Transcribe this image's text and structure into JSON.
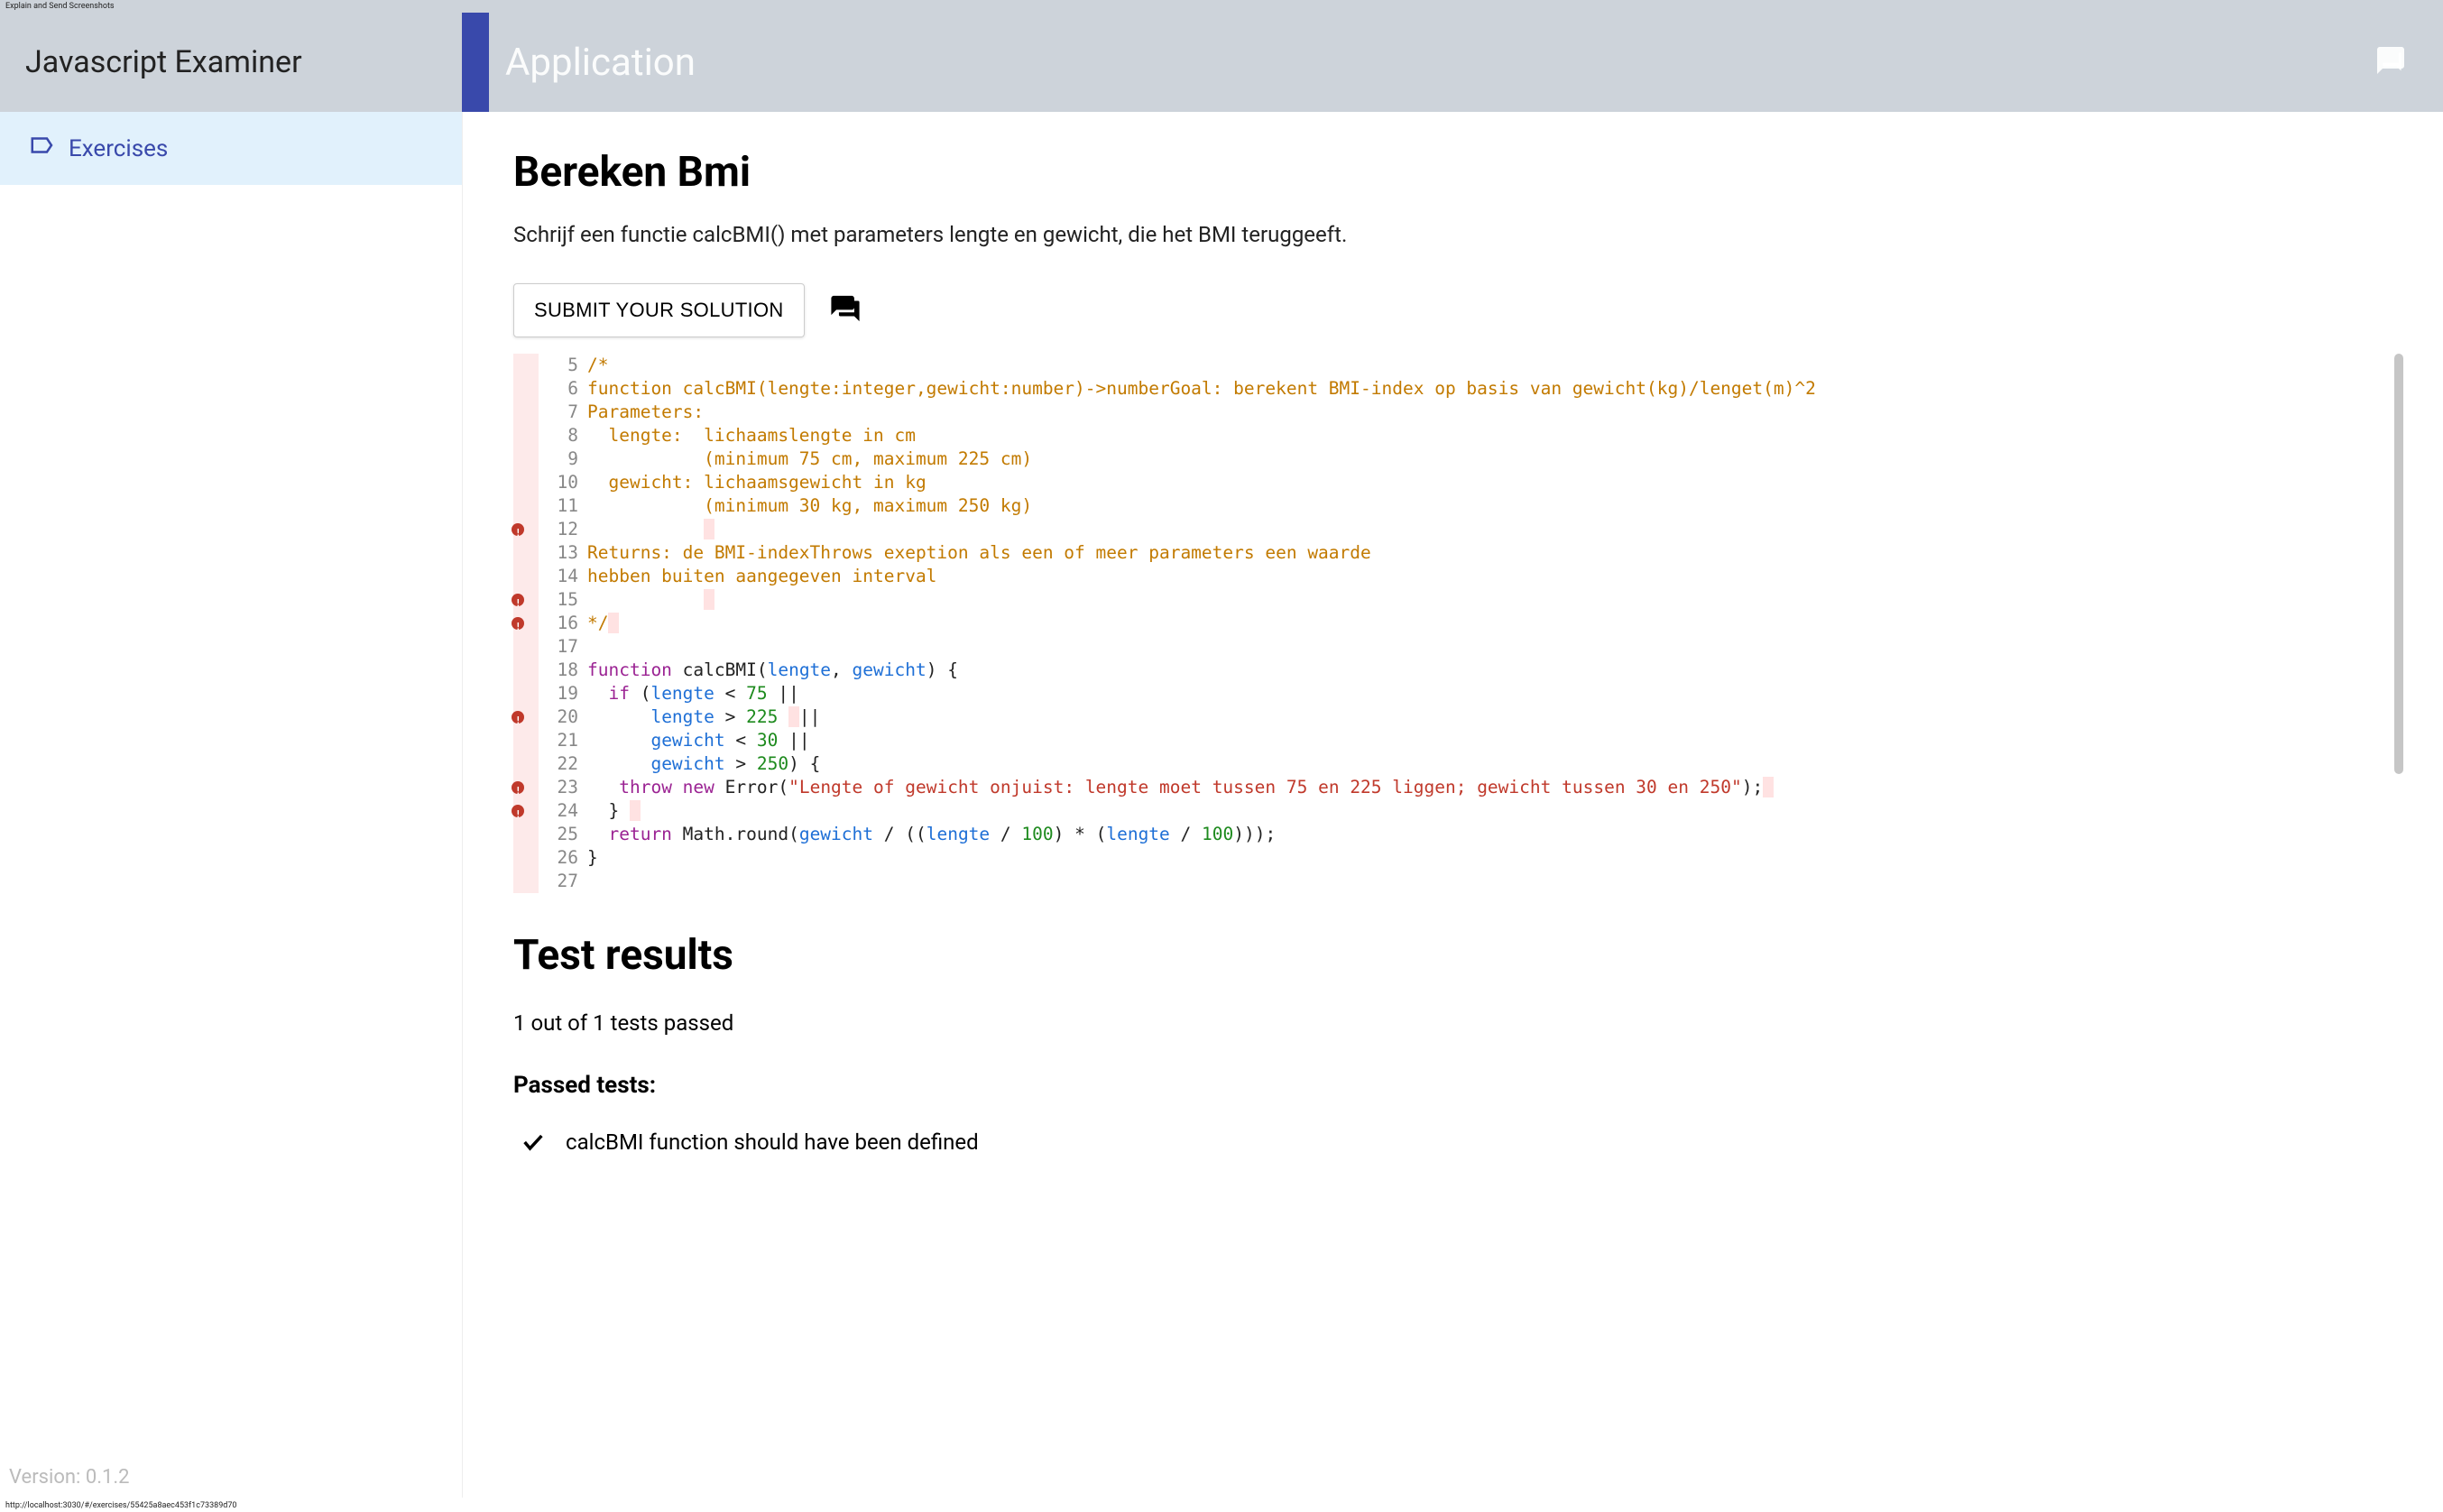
{
  "tiny_bar": "Explain and Send Screenshots",
  "header": {
    "app_name": "Javascript Examiner",
    "title": "Application"
  },
  "sidebar": {
    "items": [
      {
        "label": "Exercises"
      }
    ],
    "version": "Version: 0.1.2"
  },
  "main": {
    "title": "Bereken Bmi",
    "description": "Schrijf een functie calcBMI() met parameters lengte en gewicht, die het BMI teruggeeft.",
    "submit_label": "SUBMIT YOUR SOLUTION"
  },
  "editor": {
    "first_line_number": 5,
    "error_lines": [
      12,
      15,
      16,
      20,
      23,
      24
    ],
    "lines": [
      [
        {
          "cls": "tok-comment",
          "t": "/*"
        }
      ],
      [
        {
          "cls": "tok-comment",
          "t": "function calcBMI(lengte:integer,gewicht:number)->numberGoal: berekent BMI-index op basis van gewicht(kg)/lenget(m)^2"
        }
      ],
      [
        {
          "cls": "tok-comment",
          "t": "Parameters:"
        }
      ],
      [
        {
          "cls": "tok-comment",
          "t": "  lengte:  lichaamslengte in cm "
        }
      ],
      [
        {
          "cls": "tok-comment",
          "t": "           (minimum 75 cm, maximum 225 cm)"
        }
      ],
      [
        {
          "cls": "tok-comment",
          "t": "  gewicht: lichaamsgewicht in kg"
        }
      ],
      [
        {
          "cls": "tok-comment",
          "t": "           (minimum 30 kg, maximum 250 kg)"
        }
      ],
      [
        {
          "cls": "tok-comment",
          "t": "           "
        },
        {
          "cls": "tok-hl",
          "t": " "
        }
      ],
      [
        {
          "cls": "tok-comment",
          "t": "Returns: de BMI-indexThrows exeption als een of meer parameters een waarde "
        }
      ],
      [
        {
          "cls": "tok-comment",
          "t": "hebben buiten aangegeven interval"
        }
      ],
      [
        {
          "cls": "tok-comment",
          "t": "           "
        },
        {
          "cls": "tok-hl",
          "t": " "
        }
      ],
      [
        {
          "cls": "tok-comment",
          "t": "*/"
        },
        {
          "cls": "tok-hl",
          "t": " "
        }
      ],
      [
        {
          "cls": "tok-plain",
          "t": ""
        }
      ],
      [
        {
          "cls": "tok-kw",
          "t": "function"
        },
        {
          "cls": "tok-plain",
          "t": " calcBMI("
        },
        {
          "cls": "tok-var",
          "t": "lengte"
        },
        {
          "cls": "tok-plain",
          "t": ", "
        },
        {
          "cls": "tok-var",
          "t": "gewicht"
        },
        {
          "cls": "tok-plain",
          "t": ") {"
        }
      ],
      [
        {
          "cls": "tok-plain",
          "t": "  "
        },
        {
          "cls": "tok-kw",
          "t": "if"
        },
        {
          "cls": "tok-plain",
          "t": " ("
        },
        {
          "cls": "tok-var",
          "t": "lengte"
        },
        {
          "cls": "tok-plain",
          "t": " < "
        },
        {
          "cls": "tok-num",
          "t": "75"
        },
        {
          "cls": "tok-plain",
          "t": " ||"
        }
      ],
      [
        {
          "cls": "tok-plain",
          "t": "      "
        },
        {
          "cls": "tok-var",
          "t": "lengte"
        },
        {
          "cls": "tok-plain",
          "t": " > "
        },
        {
          "cls": "tok-num",
          "t": "225"
        },
        {
          "cls": "tok-plain",
          "t": " "
        },
        {
          "cls": "tok-hl",
          "t": " "
        },
        {
          "cls": "tok-plain",
          "t": "||"
        }
      ],
      [
        {
          "cls": "tok-plain",
          "t": "      "
        },
        {
          "cls": "tok-var",
          "t": "gewicht"
        },
        {
          "cls": "tok-plain",
          "t": " < "
        },
        {
          "cls": "tok-num",
          "t": "30"
        },
        {
          "cls": "tok-plain",
          "t": " ||"
        }
      ],
      [
        {
          "cls": "tok-plain",
          "t": "      "
        },
        {
          "cls": "tok-var",
          "t": "gewicht"
        },
        {
          "cls": "tok-plain",
          "t": " > "
        },
        {
          "cls": "tok-num",
          "t": "250"
        },
        {
          "cls": "tok-plain",
          "t": ") {"
        }
      ],
      [
        {
          "cls": "tok-plain",
          "t": "   "
        },
        {
          "cls": "tok-kw",
          "t": "throw new"
        },
        {
          "cls": "tok-plain",
          "t": " Error("
        },
        {
          "cls": "tok-str",
          "t": "\"Lengte of gewicht onjuist: lengte moet tussen 75 en 225 liggen; gewicht tussen 30 en 250\""
        },
        {
          "cls": "tok-plain",
          "t": ");"
        },
        {
          "cls": "tok-hl",
          "t": " "
        }
      ],
      [
        {
          "cls": "tok-plain",
          "t": "  } "
        },
        {
          "cls": "tok-hl",
          "t": " "
        }
      ],
      [
        {
          "cls": "tok-plain",
          "t": "  "
        },
        {
          "cls": "tok-kw",
          "t": "return"
        },
        {
          "cls": "tok-plain",
          "t": " Math.round("
        },
        {
          "cls": "tok-var",
          "t": "gewicht"
        },
        {
          "cls": "tok-plain",
          "t": " / (("
        },
        {
          "cls": "tok-var",
          "t": "lengte"
        },
        {
          "cls": "tok-plain",
          "t": " / "
        },
        {
          "cls": "tok-num",
          "t": "100"
        },
        {
          "cls": "tok-plain",
          "t": ") * ("
        },
        {
          "cls": "tok-var",
          "t": "lengte"
        },
        {
          "cls": "tok-plain",
          "t": " / "
        },
        {
          "cls": "tok-num",
          "t": "100"
        },
        {
          "cls": "tok-plain",
          "t": ")));"
        }
      ],
      [
        {
          "cls": "tok-plain",
          "t": "}"
        }
      ],
      [
        {
          "cls": "tok-plain",
          "t": ""
        }
      ]
    ]
  },
  "results": {
    "title": "Test results",
    "summary": "1 out of 1 tests passed",
    "passed_title": "Passed tests:",
    "passed_items": [
      "calcBMI function should have been defined"
    ]
  },
  "status_bar": "http://localhost:3030/#/exercises/55425a8aec453f1c73389d70"
}
